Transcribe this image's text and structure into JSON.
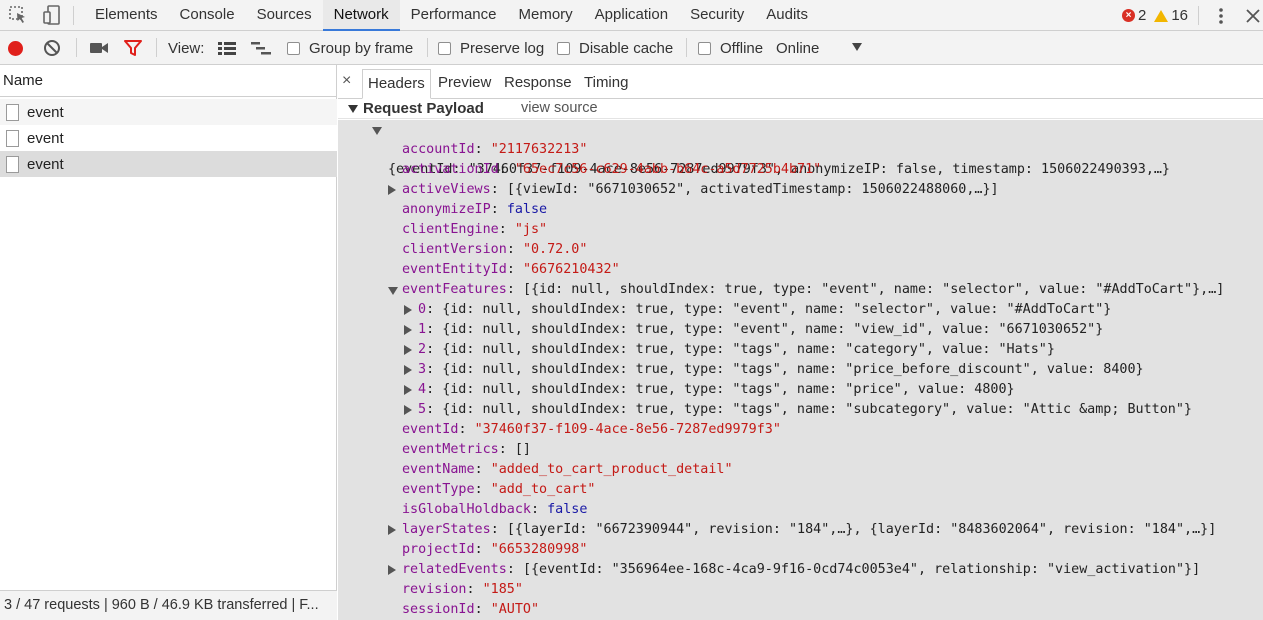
{
  "topbar": {
    "tabs": [
      "Elements",
      "Console",
      "Sources",
      "Network",
      "Performance",
      "Memory",
      "Application",
      "Security",
      "Audits"
    ],
    "active_tab": "Network",
    "error_count": "2",
    "warning_count": "16",
    "error_glyph": "×"
  },
  "toolbar": {
    "view_label": "View:",
    "group_by_frame": "Group by frame",
    "preserve_log": "Preserve log",
    "disable_cache": "Disable cache",
    "offline": "Offline",
    "throttle_value": "Online"
  },
  "request_list": {
    "header": "Name",
    "items": [
      "event",
      "event",
      "event"
    ],
    "status": "3 / 47 requests | 960 B / 46.9 KB transferred | F..."
  },
  "detail": {
    "close_glyph": "×",
    "tabs": [
      "Headers",
      "Preview",
      "Response",
      "Timing"
    ],
    "active_tab": "Headers",
    "section_title": "Request Payload",
    "view_source": "view source"
  },
  "payload_lines": [
    {
      "text": "{eventId: \"37460f37-f109-4ace-8e56-7287ed9979f3\", anonymizeIP: false, timestamp: 1506022490393,…}"
    },
    {
      "key": "accountId",
      "value": "\"2117632213\"",
      "vtype": "s"
    },
    {
      "key": "activationId",
      "value": "\"65ec7c56-c629-4abb-b64c-a5d7725b4b71\"",
      "vtype": "s"
    },
    {
      "key": "activeViews",
      "value": "[{viewId: \"6671030652\", activatedTimestamp: 1506022488060,…}]",
      "vtype": "n"
    },
    {
      "key": "anonymizeIP",
      "value": "false",
      "vtype": "b"
    },
    {
      "key": "clientEngine",
      "value": "\"js\"",
      "vtype": "s"
    },
    {
      "key": "clientVersion",
      "value": "\"0.72.0\"",
      "vtype": "s"
    },
    {
      "key": "eventEntityId",
      "value": "\"6676210432\"",
      "vtype": "s"
    },
    {
      "key": "eventFeatures",
      "value": "[{id: null, shouldIndex: true, type: \"event\", name: \"selector\", value: \"#AddToCart\"},…]",
      "vtype": "n"
    },
    {
      "key": "0",
      "value": "{id: null, shouldIndex: true, type: \"event\", name: \"selector\", value: \"#AddToCart\"}",
      "vtype": "n"
    },
    {
      "key": "1",
      "value": "{id: null, shouldIndex: true, type: \"event\", name: \"view_id\", value: \"6671030652\"}",
      "vtype": "n"
    },
    {
      "key": "2",
      "value": "{id: null, shouldIndex: true, type: \"tags\", name: \"category\", value: \"Hats\"}",
      "vtype": "n"
    },
    {
      "key": "3",
      "value": "{id: null, shouldIndex: true, type: \"tags\", name: \"price_before_discount\", value: 8400}",
      "vtype": "n"
    },
    {
      "key": "4",
      "value": "{id: null, shouldIndex: true, type: \"tags\", name: \"price\", value: 4800}",
      "vtype": "n"
    },
    {
      "key": "5",
      "value": "{id: null, shouldIndex: true, type: \"tags\", name: \"subcategory\", value: \"Attic &amp; Button\"}",
      "vtype": "n"
    },
    {
      "key": "eventId",
      "value": "\"37460f37-f109-4ace-8e56-7287ed9979f3\"",
      "vtype": "s"
    },
    {
      "key": "eventMetrics",
      "value": "[]",
      "vtype": "n"
    },
    {
      "key": "eventName",
      "value": "\"added_to_cart_product_detail\"",
      "vtype": "s"
    },
    {
      "key": "eventType",
      "value": "\"add_to_cart\"",
      "vtype": "s"
    },
    {
      "key": "isGlobalHoldback",
      "value": "false",
      "vtype": "b"
    },
    {
      "key": "layerStates",
      "value": "[{layerId: \"6672390944\", revision: \"184\",…}, {layerId: \"8483602064\", revision: \"184\",…}]",
      "vtype": "n"
    },
    {
      "key": "projectId",
      "value": "\"6653280998\"",
      "vtype": "s"
    },
    {
      "key": "relatedEvents",
      "value": "[{eventId: \"356964ee-168c-4ca9-9f16-0cd74c0053e4\", relationship: \"view_activation\"}]",
      "vtype": "n"
    },
    {
      "key": "revision",
      "value": "\"185\"",
      "vtype": "s"
    },
    {
      "key": "sessionId",
      "value": "\"AUTO\"",
      "vtype": "s"
    }
  ]
}
